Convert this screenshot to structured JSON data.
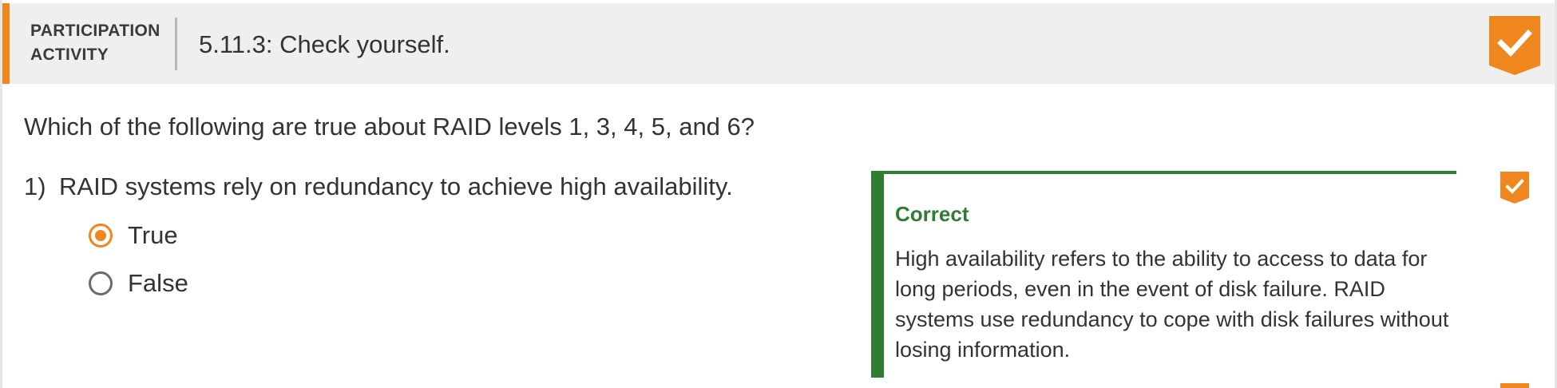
{
  "header": {
    "activity_type_line1": "PARTICIPATION",
    "activity_type_line2": "ACTIVITY",
    "title": "5.11.3: Check yourself.",
    "completion_icon": "checkmark-badge-icon",
    "accent_color": "#f0871e"
  },
  "prompt": "Which of the following are true about RAID levels 1, 3, 4, 5, and 6?",
  "questions": [
    {
      "number": "1)",
      "text": "RAID systems rely on redundancy to achieve high availability.",
      "choices": [
        {
          "label": "True",
          "selected": true
        },
        {
          "label": "False",
          "selected": false
        }
      ],
      "feedback": {
        "title": "Correct",
        "text": "High availability refers to the ability to access to data for long periods, even in the event of disk failure. RAID systems use redundancy to cope with disk failures without losing information.",
        "color": "#2e7d32"
      },
      "status_icon": "checkmark-badge-icon"
    }
  ]
}
